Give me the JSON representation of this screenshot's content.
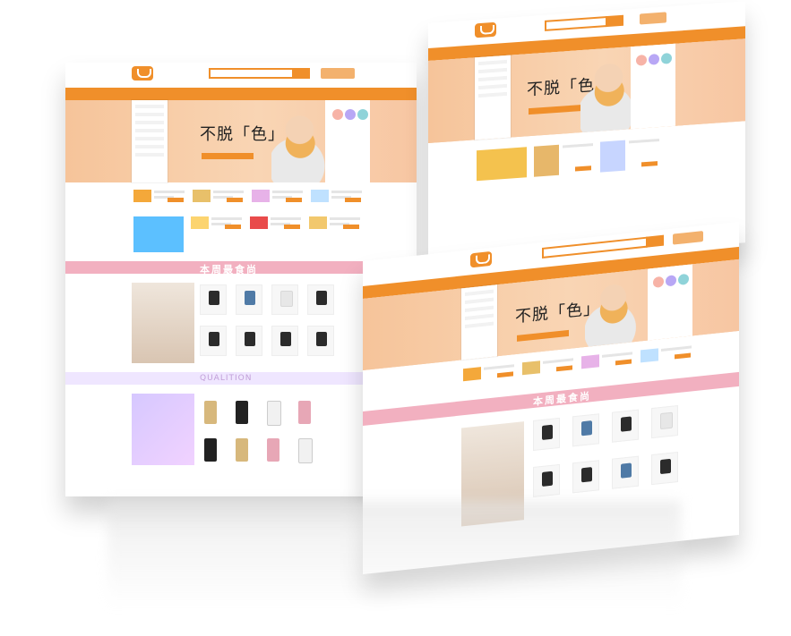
{
  "screens": {
    "left": {
      "banner": {
        "headline": "不脱「色」"
      },
      "sections": {
        "weekly_food_title": "本周最食尚",
        "quality_title": "QUALITION"
      }
    },
    "right": {
      "banner": {
        "headline": "不脱「色」"
      }
    },
    "front": {
      "banner": {
        "headline": "不脱「色」"
      },
      "sections": {
        "weekly_food_title": "本周最食尚"
      }
    }
  },
  "colors": {
    "accent": "#f08f2a",
    "pink_band": "#f2b0c0",
    "purple_band": "#efe6ff"
  }
}
